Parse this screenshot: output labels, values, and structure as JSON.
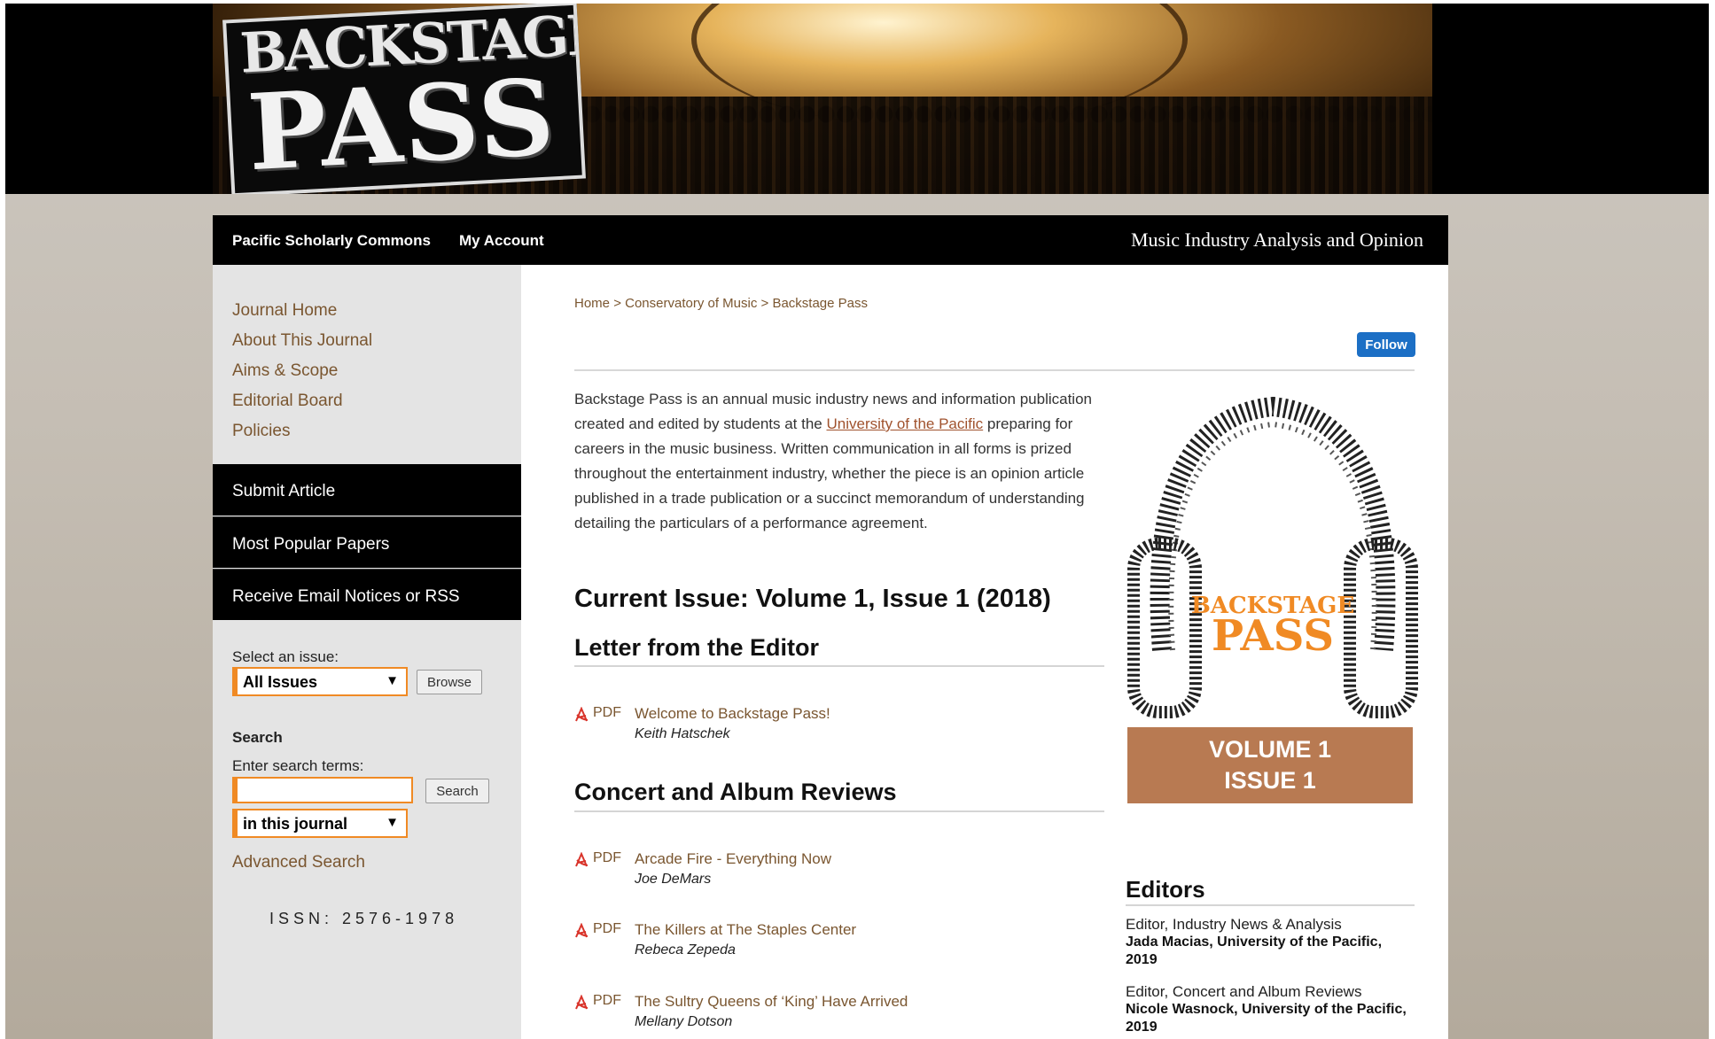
{
  "banner": {
    "logo_line1": "BACKSTAGE",
    "logo_line2": "PASS"
  },
  "topnav": {
    "links": [
      "Pacific Scholarly Commons",
      "My Account"
    ],
    "tagline": "Music Industry Analysis and Opinion"
  },
  "sidebar": {
    "links": [
      "Journal Home",
      "About This Journal",
      "Aims & Scope",
      "Editorial Board",
      "Policies"
    ],
    "actions": [
      "Submit Article",
      "Most Popular Papers",
      "Receive Email Notices or RSS"
    ],
    "select_issue_label": "Select an issue:",
    "issue_select_value": "All Issues",
    "browse_label": "Browse",
    "search_heading": "Search",
    "search_terms_label": "Enter search terms:",
    "search_input_value": "",
    "search_button": "Search",
    "scope_select_value": "in this journal",
    "advanced_search": "Advanced Search",
    "issn": "ISSN: 2576-1978"
  },
  "main": {
    "breadcrumb": [
      "Home",
      "Conservatory of Music",
      "Backstage Pass"
    ],
    "breadcrumb_sep": ">",
    "follow_label": "Follow",
    "description_pre": "Backstage Pass is an annual music industry news and information publication created and edited by students at the ",
    "description_link": "University of the Pacific",
    "description_post": " preparing for careers in the music business. Written communication in all forms is prized throughout the entertainment industry, whether the piece is an opinion article published in a trade publication or a succinct memorandum of understanding detailing the particulars of a performance agreement.",
    "current_issue": "Current Issue: Volume 1, Issue 1 (2018)",
    "sections": [
      {
        "title": "Letter from the Editor",
        "articles": [
          {
            "format": "PDF",
            "title": "Welcome to Backstage Pass!",
            "author": "Keith Hatschek"
          }
        ]
      },
      {
        "title": "Concert and Album Reviews",
        "articles": [
          {
            "format": "PDF",
            "title": "Arcade Fire - Everything Now",
            "author": "Joe DeMars"
          },
          {
            "format": "PDF",
            "title": "The Killers at The Staples Center",
            "author": "Rebeca Zepeda"
          },
          {
            "format": "PDF",
            "title": "The Sultry Queens of ‘King’ Have Arrived",
            "author": "Mellany Dotson"
          }
        ]
      }
    ],
    "cover": {
      "logo_line1": "BACKSTAGE",
      "logo_line2": "PASS",
      "volume_line1": "VOLUME 1",
      "volume_line2": "ISSUE 1"
    },
    "editors": {
      "heading": "Editors",
      "items": [
        {
          "role": "Editor, Industry News & Analysis",
          "name": "Jada Macias, University of the Pacific, 2019"
        },
        {
          "role": "Editor, Concert and Album Reviews",
          "name": "Nicole Wasnock, University of the Pacific, 2019"
        }
      ]
    }
  },
  "colors": {
    "link_brown": "#7a5630",
    "accent_orange": "#f08a24",
    "follow_blue": "#1c6fc5",
    "volume_box": "#b87a52",
    "pdf_red": "#d9342b"
  }
}
